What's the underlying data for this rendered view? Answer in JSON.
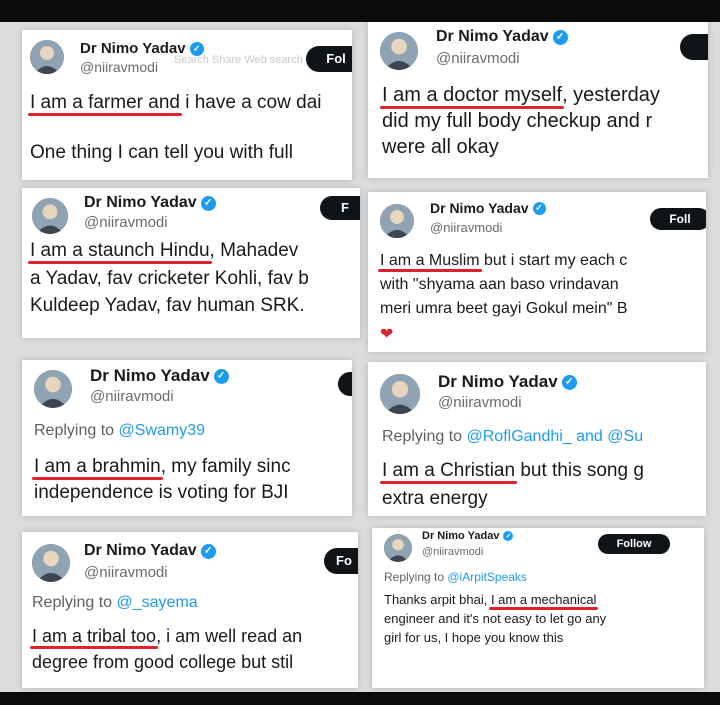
{
  "profile": {
    "name": "Dr Nimo Yadav",
    "handle": "@niiravmodi",
    "follow_label_short": "Fol",
    "follow_label": "Foll",
    "follow_label_full": "Follow",
    "follow_label_f": "F",
    "follow_label_fo": "Fo"
  },
  "colors": {
    "underline": "#e0202a",
    "verified": "#1d9bf0",
    "mention": "#1d9bf0"
  },
  "icons": [
    "verified-badge-icon",
    "heart-icon"
  ],
  "tweets": [
    {
      "header_faint": "Search   Share   Web search",
      "line1_hl": "I am a farmer and",
      "line1_rest": " i have a cow dai",
      "line2": "One thing I can tell you with full"
    },
    {
      "line1_hl": "I am a doctor myself",
      "line1_rest": ", yesterday",
      "line2": "did my full body checkup and r",
      "line3": "were all okay"
    },
    {
      "line1_hl": "I am a staunch Hindu",
      "line1_rest": ", Mahadev",
      "line2": "a Yadav, fav cricketer Kohli, fav b",
      "line3": "Kuldeep Yadav, fav human SRK."
    },
    {
      "line1_hl": "I am a Muslim",
      "line1_rest": " but i start my each c",
      "line2": "with \"shyama aan baso vrindavan",
      "line3": "meri umra beet gayi Gokul mein\" B"
    },
    {
      "reply_prefix": "Replying to ",
      "reply_to": "@Swamy39",
      "line1_hl": "I am a brahmin",
      "line1_rest": ", my family sinc",
      "line2": "independence is voting for BJI"
    },
    {
      "reply_prefix": "Replying to ",
      "reply_to": "@RoflGandhi_ and @Su",
      "line1_hl": "I am a Christian",
      "line1_rest": " but this song g",
      "line2": "extra energy"
    },
    {
      "reply_prefix": "Replying to ",
      "reply_to": "@_sayema",
      "line1_hl": "I am a tribal too",
      "line1_rest": ", i am well read an",
      "line2": "degree from good college but stil"
    },
    {
      "reply_prefix": "Replying to ",
      "reply_to": "@iArpitSpeaks",
      "line1_pre": "Thanks arpit bhai, ",
      "line1_hl": "I am a mechanical",
      "line2": "engineer and it's not easy to let go any",
      "line3": "girl  for us, I hope you know this"
    }
  ]
}
